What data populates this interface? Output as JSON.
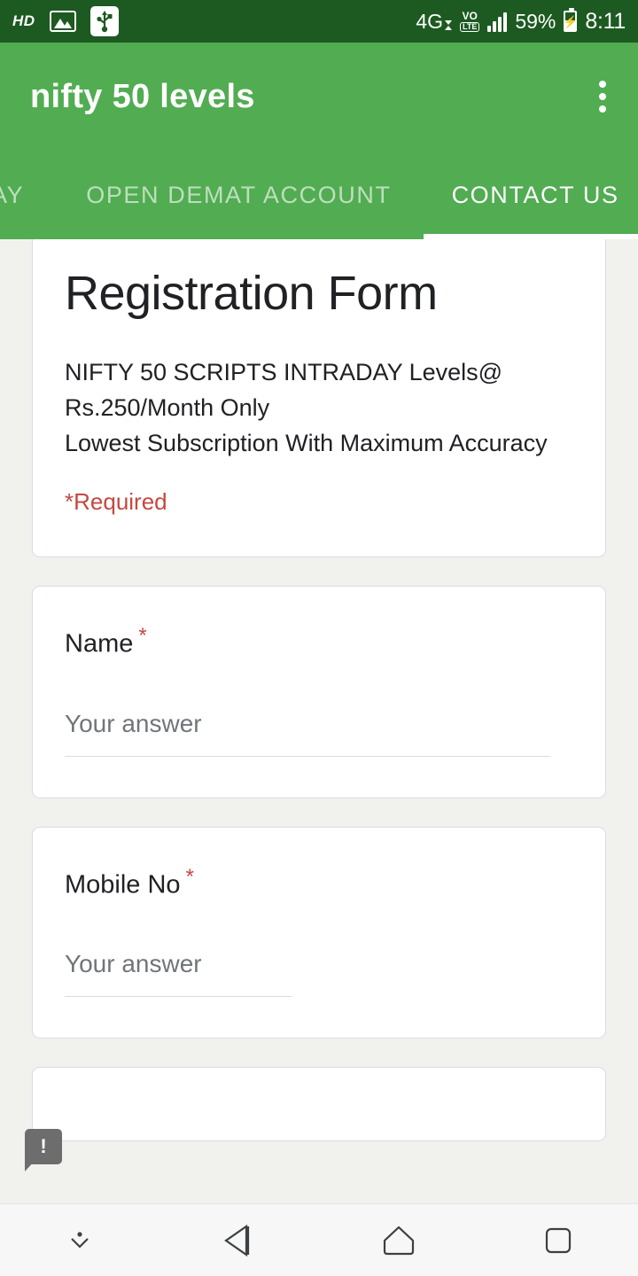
{
  "status_bar": {
    "hd_label": "HD",
    "image_icon": "image-icon",
    "usb_icon": "usb-icon",
    "network_type": "4G",
    "volte_top": "VO",
    "volte_bottom": "LTE",
    "signal_icon": "signal-bars-icon",
    "battery_percent": "59%",
    "battery_icon": "battery-charging-icon",
    "time": "8:11",
    "background_color": "#1d5a21"
  },
  "app_bar": {
    "title": "nifty 50 levels",
    "overflow_icon": "more-vert-icon",
    "background_color": "#52ac52"
  },
  "tabs": [
    {
      "label": "AY",
      "active": false
    },
    {
      "label": "OPEN DEMAT ACCOUNT",
      "active": false
    },
    {
      "label": "CONTACT US",
      "active": true
    }
  ],
  "form": {
    "title": "Registration Form",
    "description_line1": "NIFTY 50 SCRIPTS INTRADAY Levels@ Rs.250/Month Only",
    "description_line2": "Lowest Subscription With Maximum Accuracy",
    "required_note": "*Required",
    "required_marker": "*",
    "questions": [
      {
        "label": "Name",
        "required_marker": "*",
        "answer_placeholder": "Your answer",
        "field_width": "wide"
      },
      {
        "label": "Mobile No",
        "required_marker": "*",
        "answer_placeholder": "Your answer",
        "field_width": "narrow"
      }
    ]
  },
  "tooltip": {
    "icon": "exclamation-icon",
    "glyph": "!"
  },
  "nav_bar": {
    "items": [
      {
        "icon": "hide-keyboard-icon"
      },
      {
        "icon": "back-icon"
      },
      {
        "icon": "home-icon"
      },
      {
        "icon": "recents-icon"
      }
    ]
  },
  "colors": {
    "status_bar_green": "#1d5a21",
    "app_bar_green": "#52ac52",
    "required_red": "#c5483f",
    "page_background": "#f1f1ee",
    "card_background": "#ffffff",
    "placeholder_gray": "#70757a"
  }
}
